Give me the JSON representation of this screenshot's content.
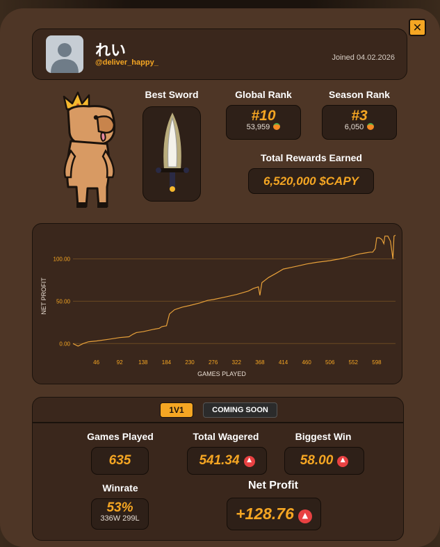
{
  "profile": {
    "name": "れい",
    "handle": "@deliver_happy_",
    "joined": "Joined 04.02.2026"
  },
  "close_label": "✕",
  "best_sword": {
    "label": "Best Sword"
  },
  "global_rank": {
    "label": "Global Rank",
    "rank": "#10",
    "points": "53,959"
  },
  "season_rank": {
    "label": "Season Rank",
    "rank": "#3",
    "points": "6,050"
  },
  "rewards": {
    "label": "Total Rewards Earned",
    "value": "6,520,000 $CAPY"
  },
  "chart_data": {
    "type": "line",
    "xlabel": "GAMES PLAYED",
    "ylabel": "NET PROFIT",
    "x_ticks": [
      46,
      92,
      138,
      184,
      230,
      276,
      322,
      368,
      414,
      460,
      506,
      552,
      598
    ],
    "y_ticks": [
      "0.00",
      "50.00",
      "100.00"
    ],
    "xlim": [
      0,
      635
    ],
    "ylim": [
      -8,
      130
    ],
    "series": [
      {
        "points": [
          [
            0,
            0
          ],
          [
            10,
            -3
          ],
          [
            20,
            0
          ],
          [
            30,
            2
          ],
          [
            46,
            3
          ],
          [
            70,
            5
          ],
          [
            92,
            7
          ],
          [
            110,
            8
          ],
          [
            118,
            11
          ],
          [
            125,
            13
          ],
          [
            138,
            14
          ],
          [
            160,
            17
          ],
          [
            170,
            18
          ],
          [
            175,
            20
          ],
          [
            184,
            21
          ],
          [
            190,
            35
          ],
          [
            200,
            40
          ],
          [
            215,
            43
          ],
          [
            230,
            45
          ],
          [
            250,
            48
          ],
          [
            265,
            51
          ],
          [
            276,
            52
          ],
          [
            300,
            55
          ],
          [
            322,
            58
          ],
          [
            345,
            62
          ],
          [
            355,
            65
          ],
          [
            365,
            67
          ],
          [
            368,
            57
          ],
          [
            372,
            72
          ],
          [
            385,
            78
          ],
          [
            400,
            83
          ],
          [
            414,
            88
          ],
          [
            430,
            90
          ],
          [
            445,
            92
          ],
          [
            460,
            94
          ],
          [
            480,
            96
          ],
          [
            506,
            98
          ],
          [
            525,
            100
          ],
          [
            540,
            102
          ],
          [
            552,
            104
          ],
          [
            558,
            105
          ],
          [
            565,
            106
          ],
          [
            575,
            107
          ],
          [
            585,
            108
          ],
          [
            590,
            108
          ],
          [
            595,
            112
          ],
          [
            598,
            125
          ],
          [
            603,
            125
          ],
          [
            608,
            123
          ],
          [
            612,
            118
          ],
          [
            614,
            127
          ],
          [
            620,
            127
          ],
          [
            625,
            121
          ],
          [
            630,
            100
          ],
          [
            632,
            127
          ],
          [
            635,
            128
          ]
        ],
        "color": "#e8a13a"
      }
    ]
  },
  "tabs": {
    "active": "1V1",
    "inactive": "COMING SOON"
  },
  "stats": {
    "games_played": {
      "label": "Games Played",
      "value": "635"
    },
    "total_wagered": {
      "label": "Total Wagered",
      "value": "541.34"
    },
    "biggest_win": {
      "label": "Biggest Win",
      "value": "58.00"
    },
    "winrate": {
      "label": "Winrate",
      "value": "53%",
      "detail": "336W 299L"
    },
    "net_profit": {
      "label": "Net Profit",
      "value": "+128.76"
    }
  },
  "colors": {
    "accent": "#f5a623",
    "panel": "#3a271c",
    "modal": "#4e3626",
    "avax": "#e84142"
  },
  "icons": [
    "user-avatar-icon",
    "close-icon",
    "capybara-king-mascot",
    "sword-icon",
    "orange-coin-icon",
    "avax-icon"
  ]
}
